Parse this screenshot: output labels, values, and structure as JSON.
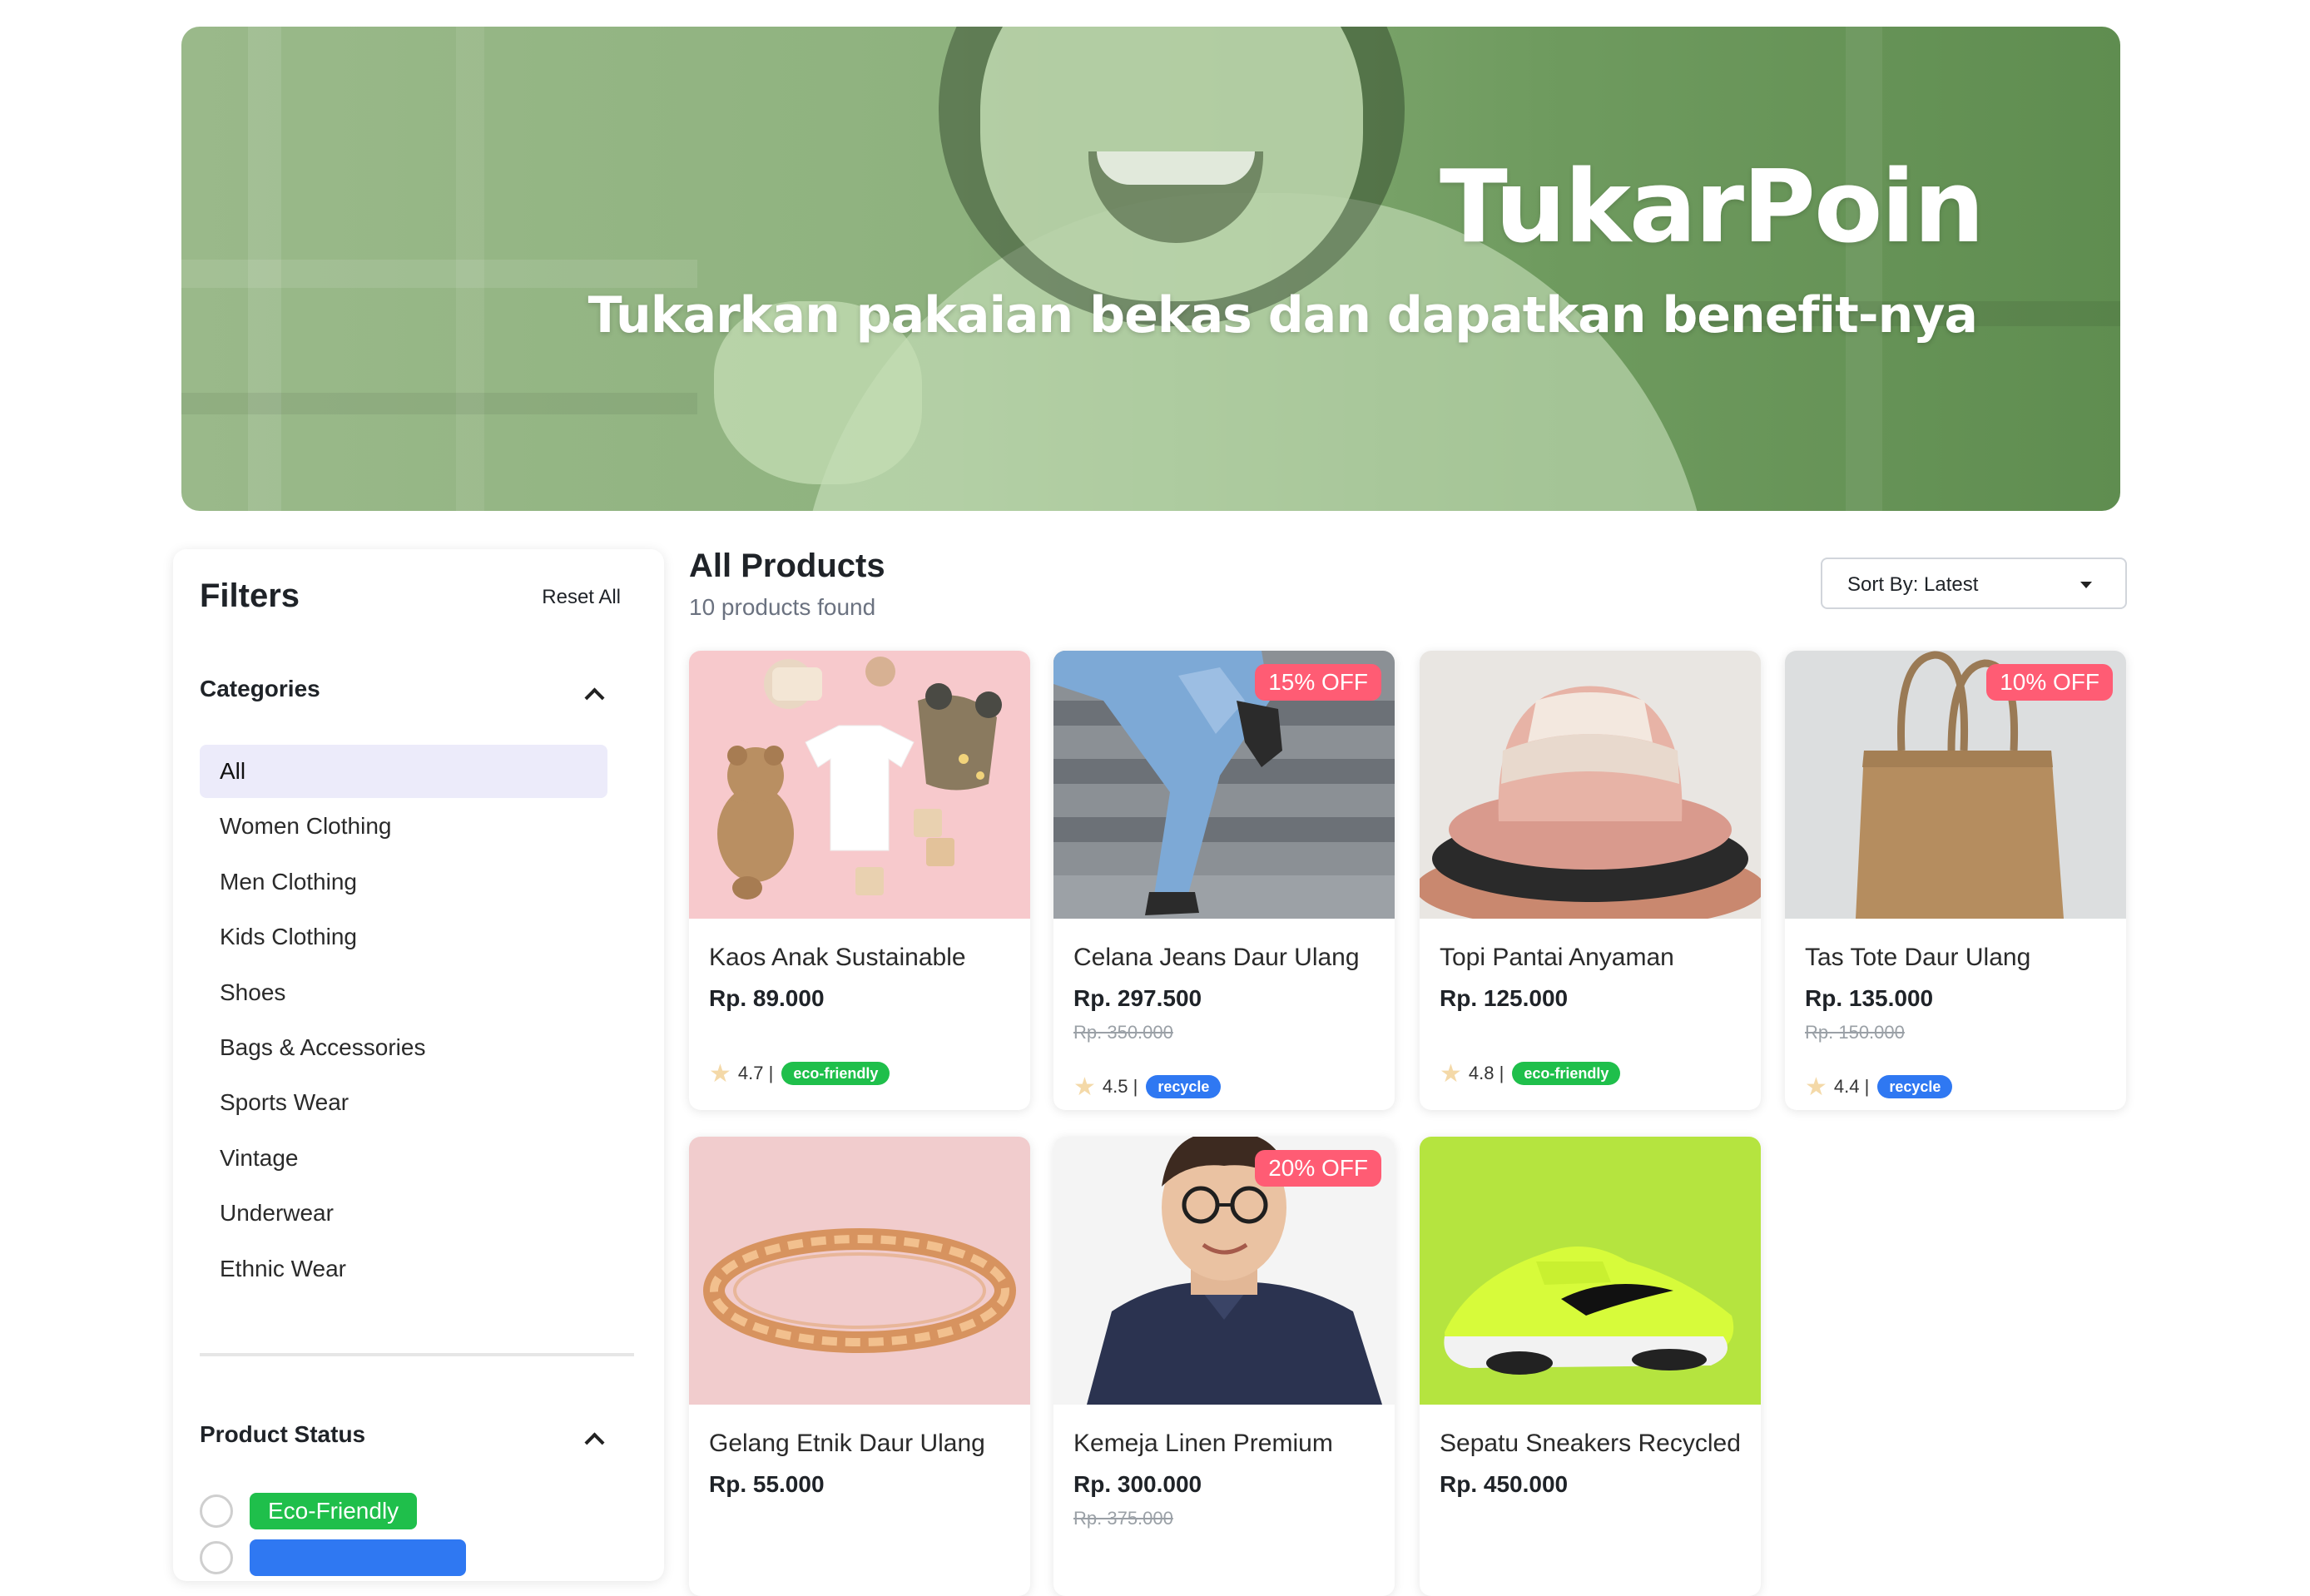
{
  "hero": {
    "title": "TukarPoin",
    "subtitle": "Tukarkan pakaian bekas dan dapatkan benefit-nya"
  },
  "filters": {
    "title": "Filters",
    "reset_label": "Reset All",
    "categories_heading": "Categories",
    "categories": [
      {
        "label": "All",
        "active": true
      },
      {
        "label": "Women Clothing",
        "active": false
      },
      {
        "label": "Men Clothing",
        "active": false
      },
      {
        "label": "Kids Clothing",
        "active": false
      },
      {
        "label": "Shoes",
        "active": false
      },
      {
        "label": "Bags & Accessories",
        "active": false
      },
      {
        "label": "Sports Wear",
        "active": false
      },
      {
        "label": "Vintage",
        "active": false
      },
      {
        "label": "Underwear",
        "active": false
      },
      {
        "label": "Ethnic Wear",
        "active": false
      }
    ],
    "status_heading": "Product Status",
    "statuses": [
      {
        "label": "Eco-Friendly",
        "color": "#1fbf4b"
      },
      {
        "label": "",
        "color": "#2f78f2"
      }
    ]
  },
  "main": {
    "title": "All Products",
    "count_text": "10 products found",
    "sort_label": "Sort By: Latest"
  },
  "products": [
    {
      "name": "Kaos Anak Sustainable",
      "price": "Rp. 89.000",
      "old_price": "",
      "discount": "",
      "rating": "4.7 |",
      "tag": "eco-friendly",
      "tag_type": "eco",
      "image": "kids-tshirt"
    },
    {
      "name": "Celana Jeans Daur Ulang",
      "price": "Rp. 297.500",
      "old_price": "Rp. 350.000",
      "discount": "15% OFF",
      "rating": "4.5 |",
      "tag": "recycle",
      "tag_type": "recycle",
      "image": "jeans"
    },
    {
      "name": "Topi Pantai Anyaman",
      "price": "Rp. 125.000",
      "old_price": "",
      "discount": "",
      "rating": "4.8 |",
      "tag": "eco-friendly",
      "tag_type": "eco",
      "image": "hat"
    },
    {
      "name": "Tas Tote Daur Ulang",
      "price": "Rp. 135.000",
      "old_price": "Rp. 150.000",
      "discount": "10% OFF",
      "rating": "4.4 |",
      "tag": "recycle",
      "tag_type": "recycle",
      "image": "tote-bag"
    },
    {
      "name": "Gelang Etnik Daur Ulang",
      "price": "Rp. 55.000",
      "old_price": "",
      "discount": "",
      "rating": "",
      "tag": "",
      "tag_type": "",
      "image": "bracelet"
    },
    {
      "name": "Kemeja Linen Premium",
      "price": "Rp. 300.000",
      "old_price": "Rp. 375.000",
      "discount": "20% OFF",
      "rating": "",
      "tag": "",
      "tag_type": "",
      "image": "shirt-man"
    },
    {
      "name": "Sepatu Sneakers Recycled",
      "price": "Rp. 450.000",
      "old_price": "",
      "discount": "",
      "rating": "",
      "tag": "",
      "tag_type": "",
      "image": "sneakers"
    }
  ]
}
